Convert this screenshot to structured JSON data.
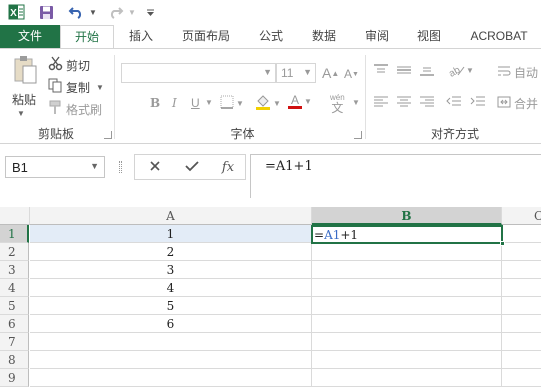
{
  "qat": {
    "excel_icon": "excel-logo-icon",
    "save_icon": "save-icon",
    "undo_icon": "undo-icon",
    "redo_icon": "redo-icon"
  },
  "tabs": [
    {
      "label": "文件"
    },
    {
      "label": "开始"
    },
    {
      "label": "插入"
    },
    {
      "label": "页面布局"
    },
    {
      "label": "公式"
    },
    {
      "label": "数据"
    },
    {
      "label": "审阅"
    },
    {
      "label": "视图"
    },
    {
      "label": "ACROBAT"
    }
  ],
  "ribbon": {
    "clipboard": {
      "paste": "粘贴",
      "cut": "剪切",
      "copy": "复制",
      "format_painter": "格式刷",
      "group_label": "剪贴板"
    },
    "font": {
      "font_size": "11",
      "bold": "B",
      "italic": "I",
      "underline": "U",
      "wen": "wén",
      "group_label": "字体"
    },
    "alignment": {
      "wrap": "自动",
      "merge": "合并",
      "group_label": "对齐方式"
    }
  },
  "formula_bar": {
    "name_box": "B1",
    "fx_label": "fx",
    "formula": "=A1+1"
  },
  "grid": {
    "columns": [
      "A",
      "B",
      "C"
    ],
    "rows": [
      "1",
      "2",
      "3",
      "4",
      "5",
      "6",
      "7",
      "8",
      "9"
    ],
    "col_a_values": [
      "1",
      "2",
      "3",
      "4",
      "5",
      "6",
      "",
      "",
      ""
    ],
    "active_cell_text": {
      "eq": "=",
      "ref": "A1",
      "rest": "+1"
    }
  },
  "colors": {
    "accent": "#217346",
    "reference_blue": "#3a6cc6"
  }
}
